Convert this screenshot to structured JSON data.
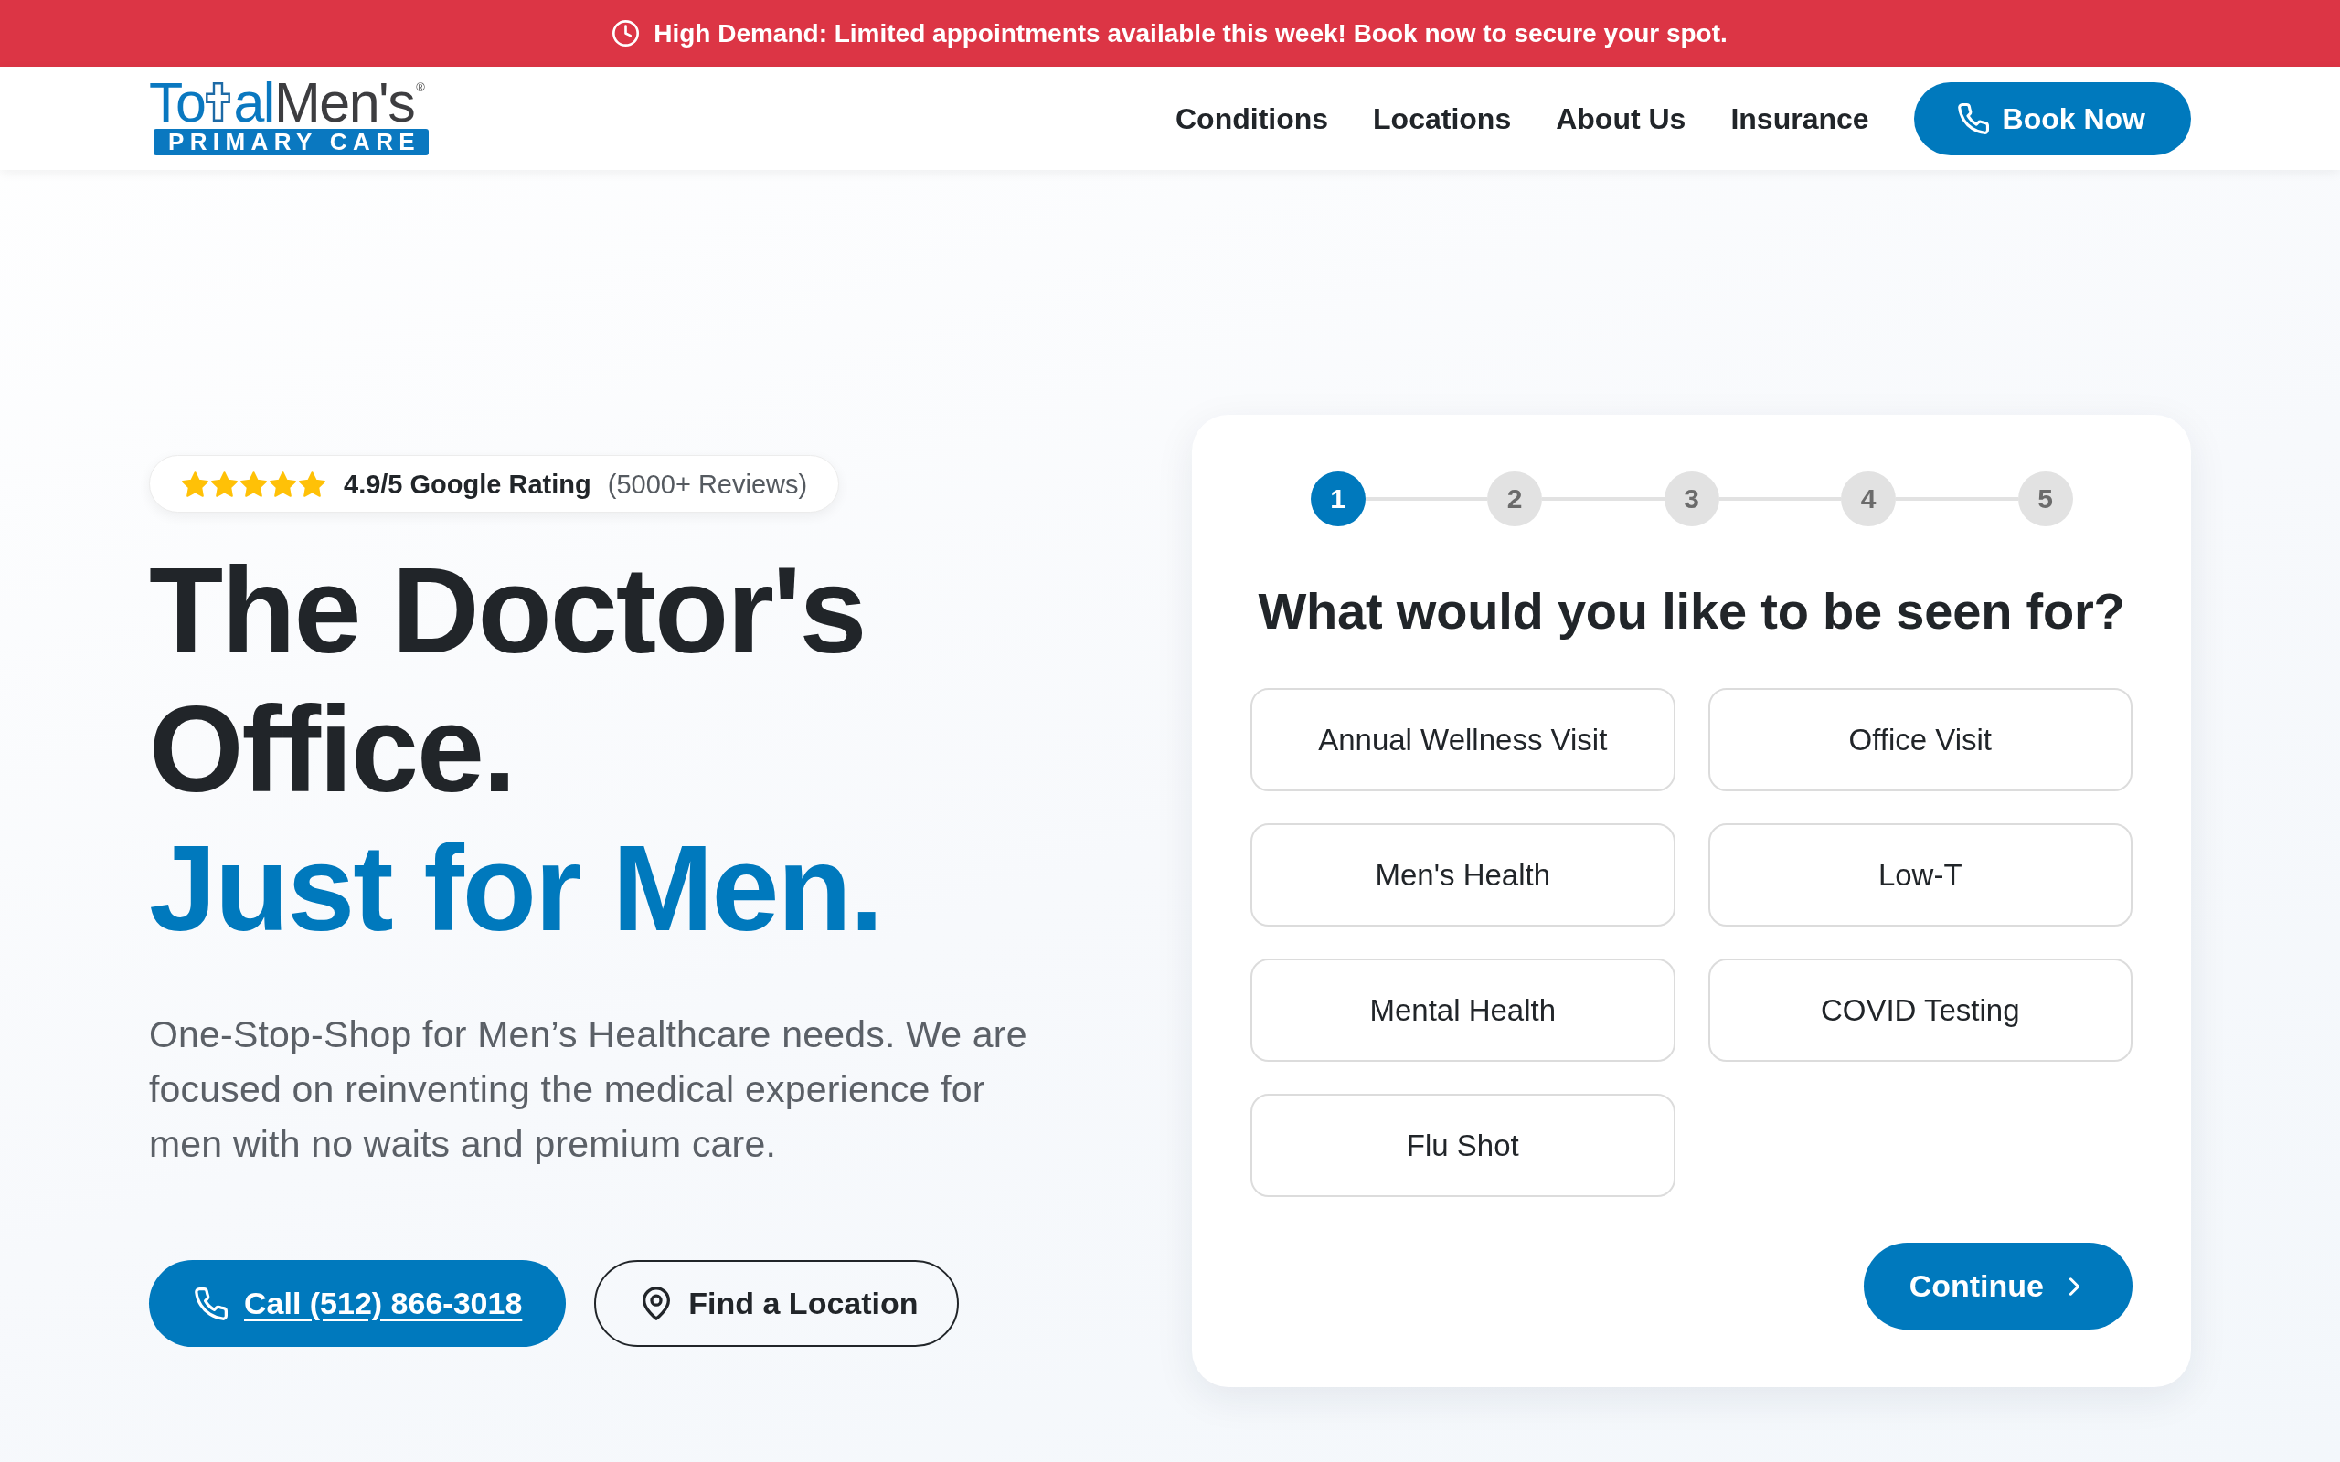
{
  "announcement": {
    "text": "High Demand: Limited appointments available this week! Book now to secure your spot."
  },
  "header": {
    "logo": {
      "wordmark_start": "To",
      "wordmark_middle": "al",
      "wordmark_end": "Men's",
      "registered_mark": "®",
      "tagline": "PRIMARY CARE"
    },
    "nav": [
      "Conditions",
      "Locations",
      "About Us",
      "Insurance"
    ],
    "cta": "Book Now"
  },
  "hero": {
    "rating": {
      "stars": 5,
      "score": "4.9/5 Google Rating",
      "reviews": "(5000+ Reviews)"
    },
    "headline": "The Doctor's Office.",
    "headline_accent": "Just for Men.",
    "description": "One-Stop-Shop for Men’s Healthcare needs. We are focused on reinventing the medical experience for men with no waits and premium care.",
    "buttons": [
      {
        "kind": "call",
        "label": "Call (512) 866-3018"
      },
      {
        "kind": "location",
        "label": "Find a Location"
      }
    ]
  },
  "booking": {
    "steps": [
      {
        "label": "1",
        "current": true
      },
      {
        "label": "2",
        "current": false
      },
      {
        "label": "3",
        "current": false
      },
      {
        "label": "4",
        "current": false
      },
      {
        "label": "5",
        "current": false
      }
    ],
    "question": "What would you like to be seen for?",
    "options": [
      {
        "label": "Annual Wellness Visit",
        "selected": false
      },
      {
        "label": "Office Visit",
        "selected": false
      },
      {
        "label": "Men's Health",
        "selected": false
      },
      {
        "label": "Low-T",
        "selected": false
      },
      {
        "label": "Mental Health",
        "selected": false
      },
      {
        "label": "COVID Testing",
        "selected": false
      },
      {
        "label": "Flu Shot",
        "selected": false
      }
    ],
    "continue": "Continue"
  }
}
